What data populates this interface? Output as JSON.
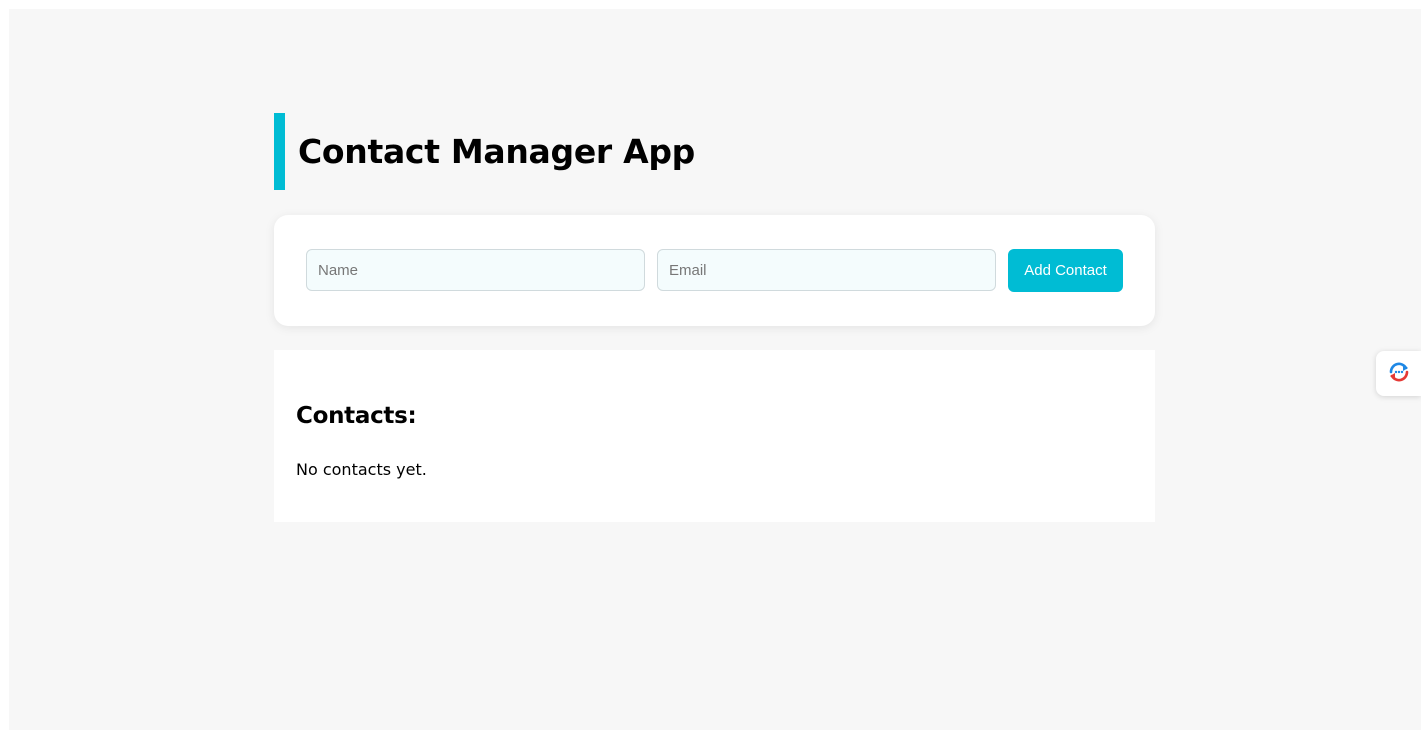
{
  "header": {
    "title": "Contact Manager App"
  },
  "form": {
    "name_placeholder": "Name",
    "name_value": "",
    "email_placeholder": "Email",
    "email_value": "",
    "add_button_label": "Add Contact"
  },
  "contacts": {
    "heading": "Contacts:",
    "empty_message": "No contacts yet.",
    "items": []
  },
  "widget": {
    "icon": "chat-sync-icon"
  },
  "colors": {
    "accent": "#00bcd4",
    "background": "#f7f7f7",
    "card": "#ffffff",
    "input_background": "#f4fcfd"
  }
}
